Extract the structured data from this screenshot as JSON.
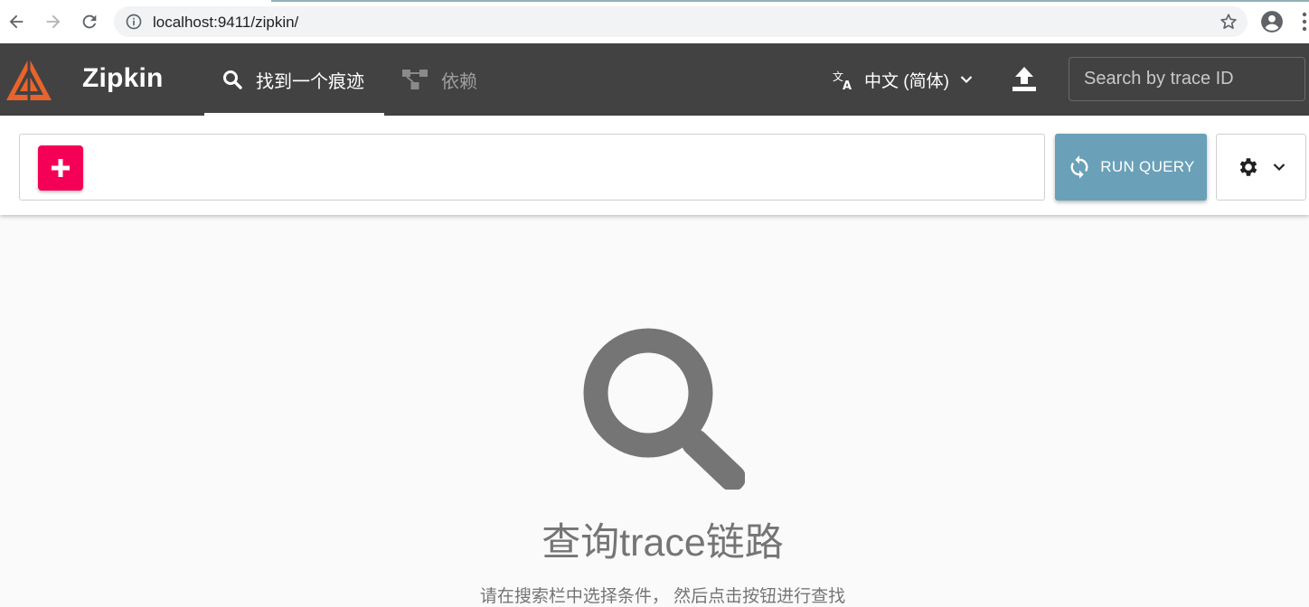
{
  "browser": {
    "url": "localhost:9411/zipkin/",
    "icons": {
      "back": "arrow-left-icon",
      "forward": "arrow-right-icon",
      "reload": "reload-icon",
      "info": "info-icon",
      "bookmark": "star-icon",
      "profile": "account-circle-icon",
      "menu": "kebab-menu-icon"
    }
  },
  "header": {
    "app_name": "Zipkin",
    "tabs": [
      {
        "label": "找到一个痕迹",
        "icon": "search-icon",
        "active": true
      },
      {
        "label": "依赖",
        "icon": "dependencies-icon",
        "active": false
      }
    ],
    "language": {
      "label": "中文 (简体)",
      "icon": "translate-icon"
    },
    "upload_icon": "upload-icon",
    "trace_search": {
      "placeholder": "Search by trace ID",
      "value": ""
    }
  },
  "query": {
    "add_icon": "plus-icon",
    "run_label": "RUN QUERY",
    "run_icon": "sync-icon",
    "settings_icon": "gear-icon"
  },
  "empty_state": {
    "icon": "search-icon",
    "title": "查询trace链路",
    "hint": "请在搜索栏中选择条件， 然后点击按钮进行查找"
  },
  "colors": {
    "header_bg": "#424242",
    "accent_pink": "#f50057",
    "run_button": "#6aa0b8",
    "logo_orange": "#e8642c",
    "background": "#fafafa"
  }
}
